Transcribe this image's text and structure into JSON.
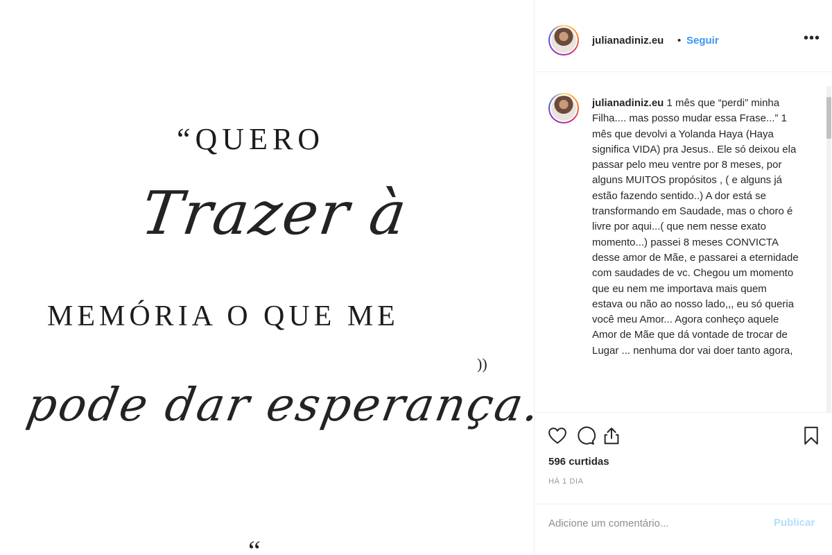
{
  "post_image": {
    "line1": "“QUERO",
    "script1": "Trazer à",
    "line3": "MEMÓRIA O QUE ME",
    "closing_quote": "))",
    "script2": "pode dar esperança.",
    "fragment": "“"
  },
  "header": {
    "username": "julianadiniz.eu",
    "separator": "•",
    "follow_label": "Seguir",
    "more_icon": "more-options-icon",
    "more_glyph": "•••"
  },
  "caption": {
    "username": "julianadiniz.eu",
    "text": " 1 mês que “perdi” minha Filha.... mas posso mudar essa Frase...” 1 mês que devolvi a Yolanda Haya (Haya significa VIDA) pra Jesus.. Ele só deixou ela passar pelo meu ventre por 8 meses, por alguns MUITOS propósitos , ( e alguns já estão fazendo sentido..) A dor está se transformando em Saudade, mas o choro é livre por aqui...( que nem nesse exato momento...) passei 8 meses CONVICTA desse amor de Mãe, e passarei a eternidade com saudades de vc. Chegou um momento que eu nem me importava mais quem estava ou não ao nosso lado,,, eu só queria você meu Amor... Agora conheço aquele Amor de Mãe que dá vontade de trocar de Lugar ... nenhuma dor vai doer tanto agora,"
  },
  "actions": {
    "like_icon": "heart-icon",
    "comment_icon": "comment-icon",
    "share_icon": "share-icon",
    "save_icon": "bookmark-icon",
    "likes_text": "596 curtidas",
    "time_text": "HÁ 1 DIA"
  },
  "comment_box": {
    "placeholder": "Adicione um comentário...",
    "publish_label": "Publicar"
  },
  "colors": {
    "link_blue": "#3897f0",
    "publish_disabled": "#b2dffc",
    "text": "#262626",
    "muted": "#999999",
    "border": "#efefef"
  }
}
